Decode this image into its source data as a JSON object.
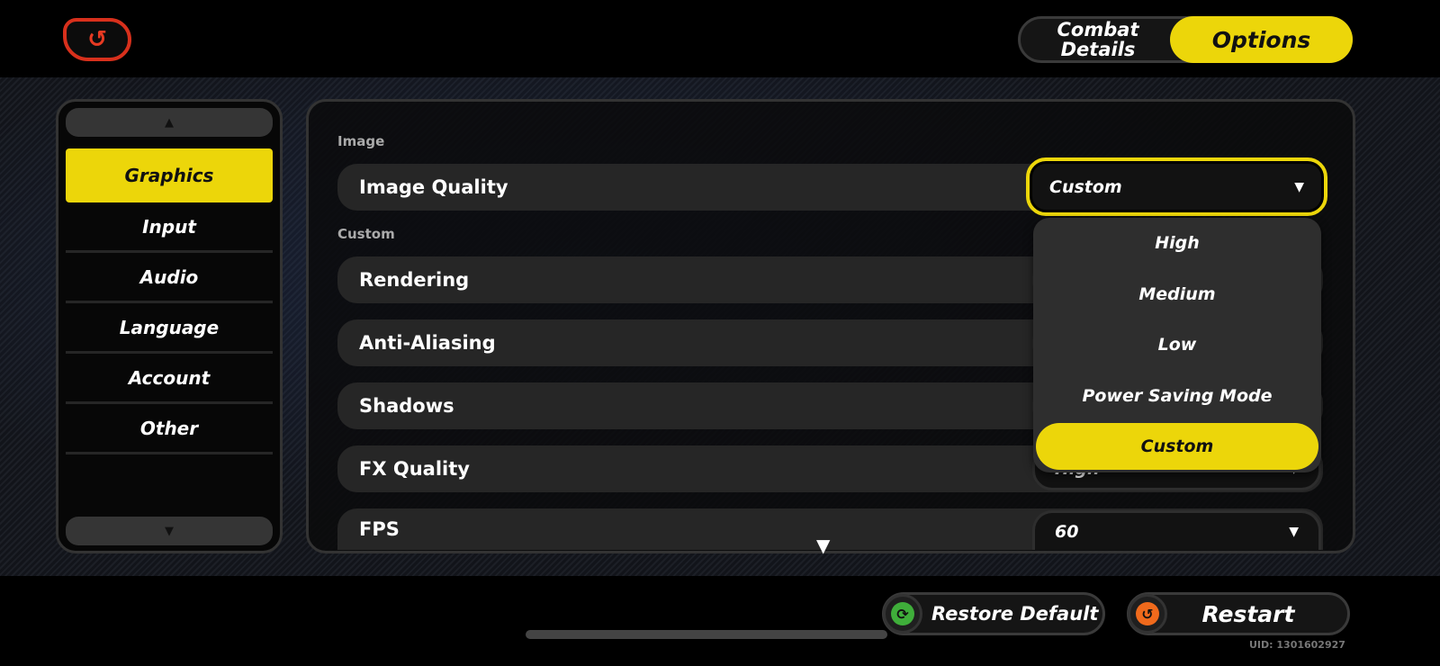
{
  "header": {
    "back_icon": "back-arrow-icon",
    "tabs": [
      {
        "label": "Combat Details",
        "active": false
      },
      {
        "label": "Options",
        "active": true
      }
    ]
  },
  "sidebar": {
    "scroll_up": "▲",
    "scroll_down": "▼",
    "items": [
      {
        "label": "Graphics",
        "active": true
      },
      {
        "label": "Input"
      },
      {
        "label": "Audio"
      },
      {
        "label": "Language"
      },
      {
        "label": "Account"
      },
      {
        "label": "Other"
      }
    ]
  },
  "main": {
    "sections": [
      {
        "label": "Image"
      },
      {
        "label": "Custom"
      }
    ],
    "rows": [
      {
        "label": "Image Quality",
        "value": "Custom"
      },
      {
        "label": "Rendering",
        "value": ""
      },
      {
        "label": "Anti-Aliasing",
        "value": ""
      },
      {
        "label": "Shadows",
        "value": ""
      },
      {
        "label": "FX Quality",
        "value": "High"
      },
      {
        "label": "FPS",
        "value": "60"
      }
    ],
    "dropdown": {
      "options": [
        "High",
        "Medium",
        "Low",
        "Power Saving Mode",
        "Custom"
      ],
      "selected": "Custom"
    },
    "more_indicator": "▼"
  },
  "footer": {
    "restore_label": "Restore Default",
    "restart_label": "Restart",
    "uid": "UID: 1301602927"
  },
  "colors": {
    "accent": "#ecd60a",
    "back": "#d8301c",
    "restore_icon": "#3fae3a",
    "restart_icon": "#f06a1c"
  }
}
